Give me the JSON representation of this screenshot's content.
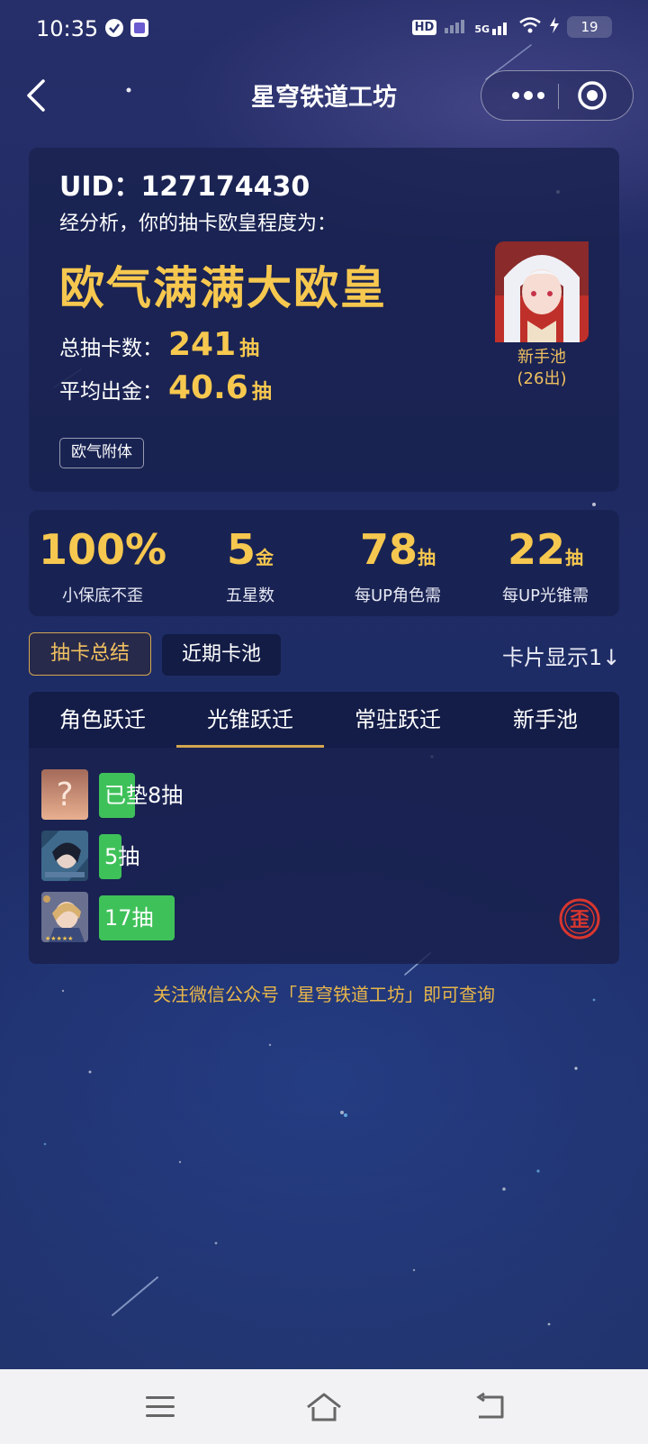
{
  "status_bar": {
    "time": "10:35",
    "battery": "19",
    "hd_label": "HD",
    "network_label": "5G"
  },
  "nav": {
    "title": "星穹铁道工坊"
  },
  "summary": {
    "uid_label": "UID：",
    "uid": "127174430",
    "analysis": "经分析，你的抽卡欧皇程度为：",
    "verdict": "欧气满满大欧皇",
    "total_label": "总抽卡数：",
    "total_value": "241",
    "avg_label": "平均出金：",
    "avg_value": "40.6",
    "unit": "抽",
    "tag": "欧气附体",
    "pool_name": "新手池",
    "pool_count": "(26出)"
  },
  "stats": [
    {
      "value": "100%",
      "unit": "",
      "label": "小保底不歪"
    },
    {
      "value": "5",
      "unit": "金",
      "label": "五星数"
    },
    {
      "value": "78",
      "unit": "抽",
      "label": "每UP角色需"
    },
    {
      "value": "22",
      "unit": "抽",
      "label": "每UP光锥需"
    }
  ],
  "toggles": {
    "summary": "抽卡总结",
    "recent": "近期卡池",
    "card_display": "卡片显示1↓"
  },
  "tabs": [
    {
      "label": "角色跃迁",
      "active": false
    },
    {
      "label": "光锥跃迁",
      "active": true
    },
    {
      "label": "常驻跃迁",
      "active": false
    },
    {
      "label": "新手池",
      "active": false
    }
  ],
  "pulls": [
    {
      "text": "已垫8抽",
      "pulls": 8
    },
    {
      "text": "5抽",
      "pulls": 5
    },
    {
      "text": "17抽",
      "pulls": 17
    }
  ],
  "wai_badge": "歪",
  "footer": "关注微信公众号「星穹铁道工坊」即可查询",
  "colors": {
    "gold": "#f7c84f",
    "progress_green": "#3fc15a",
    "badge_red": "#d8362f"
  }
}
